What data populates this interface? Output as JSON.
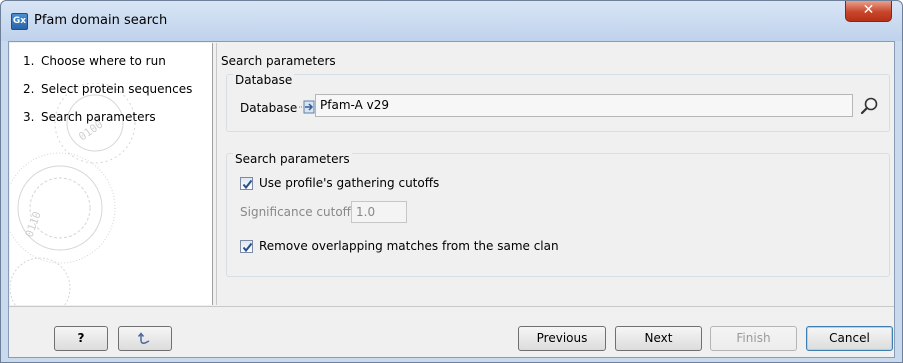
{
  "window": {
    "title": "Pfam domain search",
    "app_icon_text": "Gx",
    "close_glyph": "✕"
  },
  "steps": [
    {
      "num": "1.",
      "label": "Choose where to run"
    },
    {
      "num": "2.",
      "label": "Select protein sequences"
    },
    {
      "num": "3.",
      "label": "Search parameters"
    }
  ],
  "content": {
    "section_title": "Search parameters",
    "database_group": {
      "title": "Database",
      "field_label": "Database",
      "field_value": "Pfam-A v29",
      "browse_icon": "magnifier-icon"
    },
    "params_group": {
      "title": "Search parameters",
      "gathering_cutoff_label": "Use profile's gathering cutoffs",
      "gathering_cutoff_checked": true,
      "significance_label": "Significance cutoff",
      "significance_value": "1.0",
      "remove_overlap_label": "Remove overlapping matches from the same clan",
      "remove_overlap_checked": true
    }
  },
  "footer": {
    "help_label": "?",
    "previous_label": "Previous",
    "next_label": "Next",
    "finish_label": "Finish",
    "cancel_label": "Cancel"
  },
  "colors": {
    "title_bg": "#bfd2ec",
    "close_bg": "#c7452b",
    "dialog_bg": "#f0f0f0",
    "default_button_border": "#3c7fb1"
  }
}
